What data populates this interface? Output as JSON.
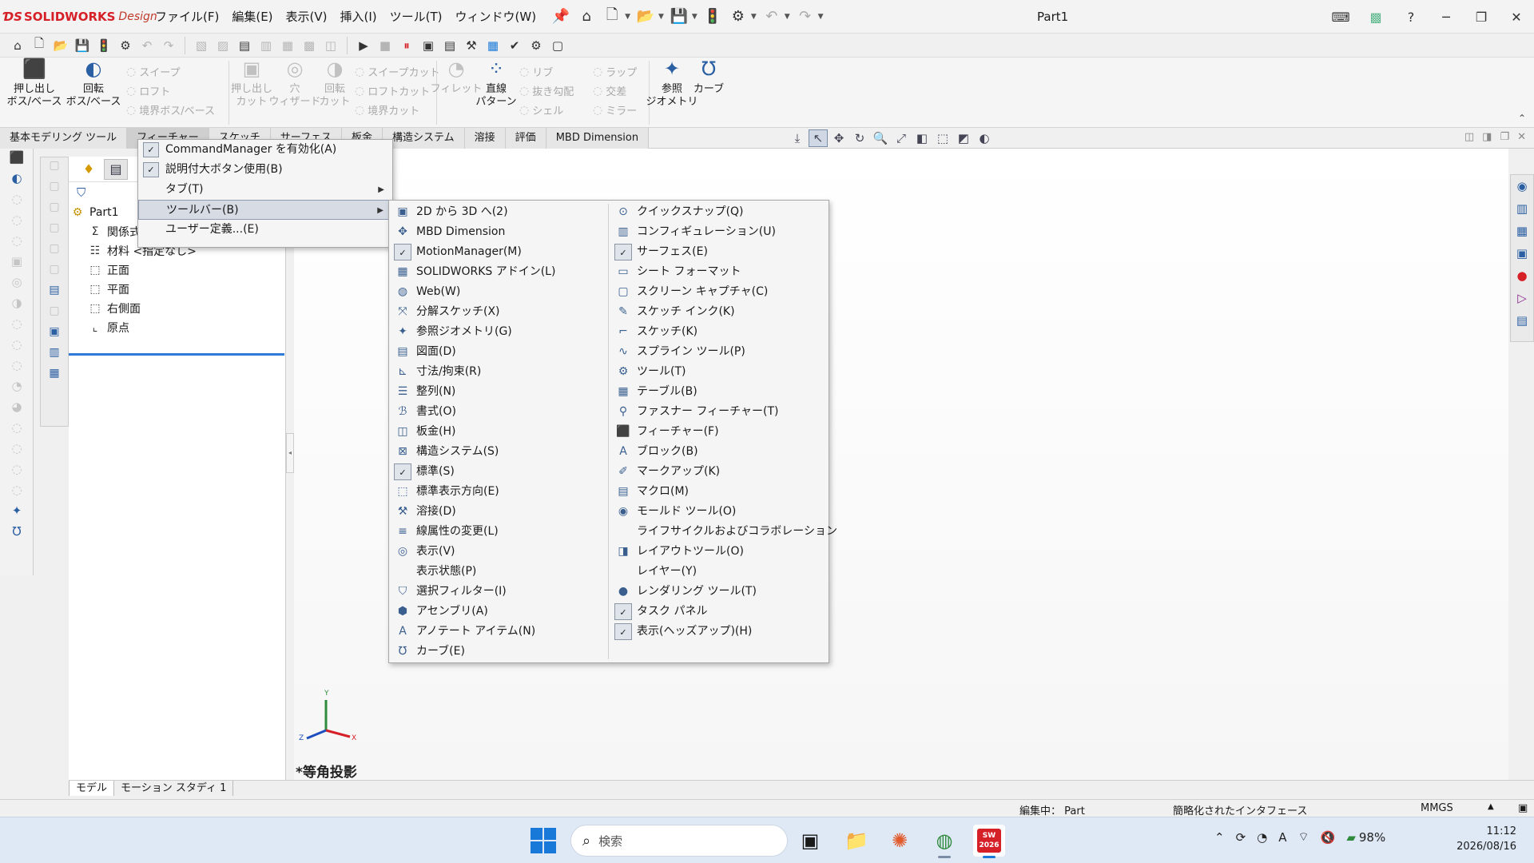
{
  "app": {
    "brand": "SOLIDWORKS",
    "brand_suffix": "Design",
    "doc_title": "Part1"
  },
  "menubar": [
    "ファイル(F)",
    "編集(E)",
    "表示(V)",
    "挿入(I)",
    "ツール(T)",
    "ウィンドウ(W)"
  ],
  "ribbon": {
    "extrude_boss": "押し出し\nボス/ベース",
    "revolve_boss": "回転\nボス/ベース",
    "sweep": "スイープ",
    "loft": "ロフト",
    "boundary_boss": "境界ボス/ベース",
    "extrude_cut": "押し出し\nカット",
    "hole_wizard": "穴\nウィザード",
    "revolve_cut": "回転\nカット",
    "sweep_cut": "スイープカット",
    "loft_cut": "ロフトカット",
    "boundary_cut": "境界カット",
    "fillet": "フィレット",
    "linear_pattern": "直線\nパターン",
    "rib": "リブ",
    "draft": "抜き勾配",
    "shell": "シェル",
    "wrap": "ラップ",
    "intersect": "交差",
    "mirror": "ミラー",
    "ref_geometry": "参照\nジオメトリ",
    "curves": "カーブ"
  },
  "command_tabs": [
    "基本モデリング ツール",
    "フィーチャー",
    "スケッチ",
    "サーフェス",
    "板金",
    "構造システム",
    "溶接",
    "評価",
    "MBD Dimension"
  ],
  "tree": {
    "root": "Part1",
    "items": [
      "関係式",
      "材料 <指定なし>",
      "正面",
      "平面",
      "右側面",
      "原点"
    ]
  },
  "view_label": "*等角投影",
  "model_tabs": [
    "モデル",
    "モーション スタディ 1"
  ],
  "status": {
    "editing": "編集中： Part",
    "interface": "簡略化されたインタフェース",
    "units": "MMGS"
  },
  "context_menu": {
    "items": [
      {
        "label": "CommandManager を有効化(A)",
        "checked": true
      },
      {
        "label": "説明付大ボタン使用(B)",
        "checked": true
      },
      {
        "label": "タブ(T)",
        "submenu": true
      },
      {
        "label": "ツールバー(B)",
        "submenu": true,
        "highlight": true
      },
      {
        "label": "ユーザー定義...(E)"
      }
    ]
  },
  "toolbar_menu": {
    "col1": [
      {
        "label": "2D から 3D へ(2)",
        "icon": "2d-to-3d-icon"
      },
      {
        "label": "MBD Dimension",
        "icon": "mbd-icon"
      },
      {
        "label": "MotionManager(M)",
        "icon": "check-icon",
        "checked": true
      },
      {
        "label": "SOLIDWORKS アドイン(L)",
        "icon": "addin-icon"
      },
      {
        "label": "Web(W)",
        "icon": "globe-icon"
      },
      {
        "label": "分解スケッチ(X)",
        "icon": "explode-sketch-icon"
      },
      {
        "label": "参照ジオメトリ(G)",
        "icon": "reference-geometry-icon"
      },
      {
        "label": "図面(D)",
        "icon": "drawing-icon"
      },
      {
        "label": "寸法/拘束(R)",
        "icon": "dimension-icon"
      },
      {
        "label": "整列(N)",
        "icon": "align-icon"
      },
      {
        "label": "書式(O)",
        "icon": "format-icon"
      },
      {
        "label": "板金(H)",
        "icon": "sheet-metal-icon"
      },
      {
        "label": "構造システム(S)",
        "icon": "structure-icon"
      },
      {
        "label": "標準(S)",
        "icon": "standard-icon",
        "checked": true
      },
      {
        "label": "標準表示方向(E)",
        "icon": "view-orientation-icon"
      },
      {
        "label": "溶接(D)",
        "icon": "weld-icon"
      },
      {
        "label": "線属性の変更(L)",
        "icon": "line-format-icon"
      },
      {
        "label": "表示(V)",
        "icon": "view-icon"
      },
      {
        "label": "表示状態(P)",
        "icon": ""
      },
      {
        "label": "選択フィルター(I)",
        "icon": "filter-icon"
      },
      {
        "label": "アセンブリ(A)",
        "icon": "assembly-icon"
      },
      {
        "label": "アノテート アイテム(N)",
        "icon": "annotation-icon"
      },
      {
        "label": "カーブ(E)",
        "icon": "curve-icon"
      }
    ],
    "col2": [
      {
        "label": "クイックスナップ(Q)",
        "icon": "quick-snap-icon"
      },
      {
        "label": "コンフィギュレーション(U)",
        "icon": "configuration-icon"
      },
      {
        "label": "サーフェス(E)",
        "icon": "surface-icon",
        "checked": true
      },
      {
        "label": "シート フォーマット",
        "icon": "sheet-format-icon"
      },
      {
        "label": "スクリーン キャプチャ(C)",
        "icon": "screen-capture-icon"
      },
      {
        "label": "スケッチ インク(K)",
        "icon": "sketch-ink-icon"
      },
      {
        "label": "スケッチ(K)",
        "icon": "sketch-icon"
      },
      {
        "label": "スプライン ツール(P)",
        "icon": "spline-icon"
      },
      {
        "label": "ツール(T)",
        "icon": "tools-icon"
      },
      {
        "label": "テーブル(B)",
        "icon": "table-icon"
      },
      {
        "label": "ファスナー フィーチャー(T)",
        "icon": "fastener-icon"
      },
      {
        "label": "フィーチャー(F)",
        "icon": "features-icon"
      },
      {
        "label": "ブロック(B)",
        "icon": "block-icon"
      },
      {
        "label": "マークアップ(K)",
        "icon": "markup-icon"
      },
      {
        "label": "マクロ(M)",
        "icon": "macro-icon"
      },
      {
        "label": "モールド ツール(O)",
        "icon": "mold-icon"
      },
      {
        "label": "ライフサイクルおよびコラボレーション",
        "icon": ""
      },
      {
        "label": "レイアウトツール(O)",
        "icon": "layout-icon"
      },
      {
        "label": "レイヤー(Y)",
        "icon": ""
      },
      {
        "label": "レンダリング ツール(T)",
        "icon": "render-icon"
      },
      {
        "label": "タスク パネル",
        "icon": "check-icon",
        "checked": true
      },
      {
        "label": "表示(ヘッズアップ)(H)",
        "icon": "check-icon",
        "checked": true
      }
    ]
  },
  "taskbar": {
    "search_placeholder": "検索",
    "battery": "98%",
    "time": "11:12",
    "date": "2026/08/16",
    "sw_badge": "SW\n2026"
  },
  "colors": {
    "accent": "#2f7ad6",
    "brand_red": "#d62027",
    "taskbar_bg": "#dfe8f5"
  }
}
